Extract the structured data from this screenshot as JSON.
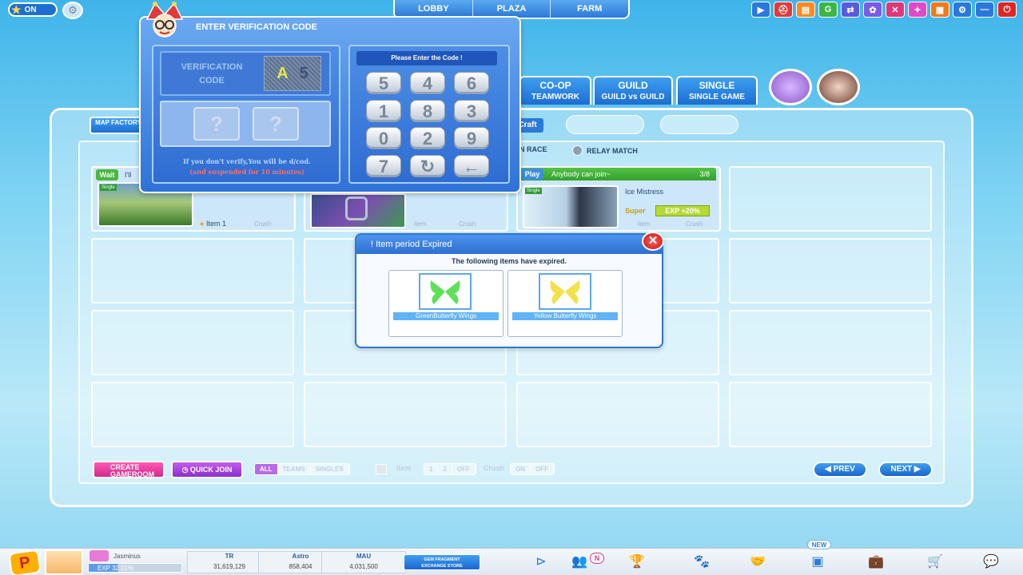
{
  "topbar": {
    "toggle_label": "ON",
    "tabs": [
      "LOBBY",
      "PLAZA",
      "FARM"
    ],
    "icons": [
      {
        "name": "play-icon",
        "glyph": "▶",
        "color": "#2a78dc"
      },
      {
        "name": "helmet-icon",
        "glyph": "⛑",
        "color": "#e23a3a"
      },
      {
        "name": "story-icon",
        "glyph": "▤",
        "color": "#ff8a1d"
      },
      {
        "name": "g-icon",
        "glyph": "G",
        "color": "#3cb544"
      },
      {
        "name": "arrows-icon",
        "glyph": "⇄",
        "color": "#5a5ae0"
      },
      {
        "name": "settings-wheel-icon",
        "glyph": "✿",
        "color": "#7a5ae8"
      },
      {
        "name": "cross-icon",
        "glyph": "✕",
        "color": "#e0367a"
      },
      {
        "name": "sparkle-icon",
        "glyph": "✦",
        "color": "#e04ac8"
      },
      {
        "name": "book-icon",
        "glyph": "▦",
        "color": "#f07a1a"
      },
      {
        "name": "gear-icon",
        "glyph": "⚙",
        "color": "#2a78dc"
      },
      {
        "name": "minimize-icon",
        "glyph": "—",
        "color": "#2a78dc"
      },
      {
        "name": "power-icon",
        "glyph": "⏻",
        "color": "#e02424"
      }
    ]
  },
  "mode_tabs": [
    {
      "title": "CO-OP",
      "sub": "TEAMWORK"
    },
    {
      "title": "GUILD",
      "sub": "GUILD vs GUILD"
    },
    {
      "title": "SINGLE",
      "sub": "SINGLE GAME"
    }
  ],
  "map_factory": "MAP FACTORY",
  "craft_label": "Craft",
  "race_options": [
    "N RACE",
    "RELAY MATCH"
  ],
  "rooms": {
    "room1": {
      "tag": "Wait",
      "partial_title": "I'll",
      "item_label": "Item 1",
      "crush_label": "Crush",
      "badge": "Single"
    },
    "room2": {
      "item_label": "Item",
      "crush_label": "Crush"
    },
    "room3": {
      "tag": "Play",
      "status": "Anybody can join~",
      "count": "3/8",
      "map_name": "Ice Mistress",
      "exp_bonus": "EXP +20%",
      "item_label": "Item",
      "crush_label": "Crush",
      "badge": "Single",
      "super_label": "Super"
    }
  },
  "bottom_controls": {
    "create_room": "CREATE GAMEROOM",
    "quick_join": "QUICK JOIN",
    "team_filter": [
      "ALL",
      "TEAMS",
      "SINGLES"
    ],
    "item_label": "Item",
    "item_options": [
      "1",
      "2",
      "OFF"
    ],
    "crush_label": "Crush",
    "crush_options": [
      "ON",
      "OFF"
    ],
    "prev": "PREV",
    "next": "NEXT"
  },
  "verification_dialog": {
    "title": "ENTER VERIFICATION CODE",
    "code_label_line1": "VERIFICATION",
    "code_label_line2": "CODE",
    "captcha_chars": [
      "A",
      "5"
    ],
    "input_placeholders": [
      "?",
      "?"
    ],
    "warning_line1": "If you don't verify,You will be d/cod.",
    "warning_line2": "(and suspended for 10 minutes)",
    "keypad_title": "Please Enter the Code !",
    "keys": [
      "5",
      "4",
      "6",
      "1",
      "8",
      "3",
      "0",
      "2",
      "9",
      "7",
      "↻",
      "←"
    ],
    "warning_color": "#bcd8f7",
    "warning_red": "#ff6b6b"
  },
  "expired_dialog": {
    "title": "! Item period Expired",
    "message": "The following items have expired.",
    "items": [
      {
        "name": "GreenButterfly Wings",
        "color": "#5ee05a"
      },
      {
        "name": "Yellow Butterfly Wings",
        "color": "#f3e04a"
      }
    ]
  },
  "bottom_bar": {
    "p_badge": "P",
    "username": "Jasminus",
    "exp_label": "EXP 32.01%",
    "exp_progress": 0.3201,
    "stats": [
      {
        "label": "TR",
        "value": "31,619,129"
      },
      {
        "label": "Astro",
        "value": "858,404"
      },
      {
        "label": "MAU",
        "value": "4,031,500"
      }
    ],
    "gem_button_line1": "GEM FRAGMENT",
    "gem_button_line2": "EXCHANGE STORE",
    "new_badge": "NEW",
    "notify_badge": "N"
  }
}
